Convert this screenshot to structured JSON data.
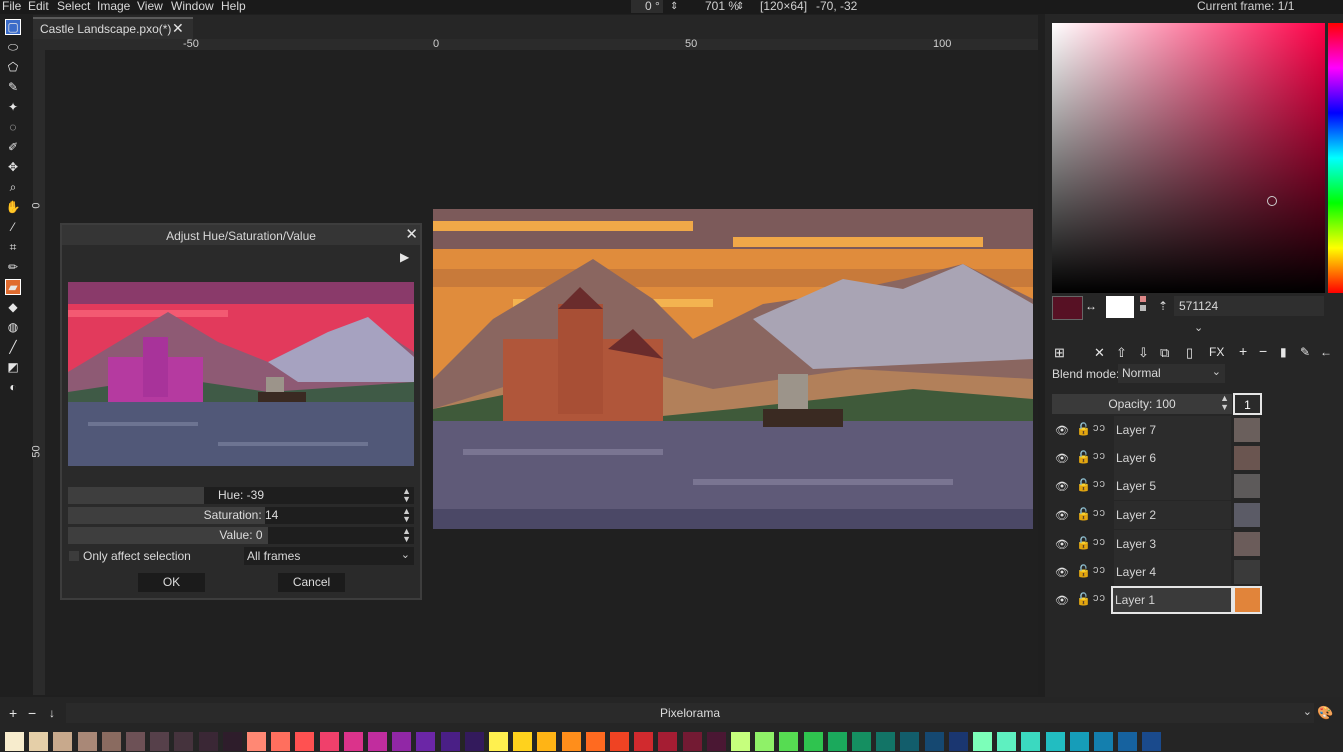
{
  "menu": [
    "File",
    "Edit",
    "Select",
    "Image",
    "View",
    "Window",
    "Help"
  ],
  "status": {
    "rotation": "0 °",
    "zoom": "701 %",
    "canvas_size": "[120×64]",
    "cursor": "-70, -32",
    "current_frame": "Current frame: 1/1"
  },
  "tab": {
    "label": "Castle Landscape.pxo(*)",
    "close": "✕"
  },
  "ruler_top": [
    "-50",
    "0",
    "50",
    "100"
  ],
  "ruler_left": [
    "0",
    "50"
  ],
  "dialog": {
    "title": "Adjust Hue/Saturation/Value",
    "close": "✕",
    "hue": {
      "label": "Hue: -39",
      "value": -39
    },
    "saturation": {
      "label": "Saturation: 14",
      "value": 14
    },
    "value": {
      "label": "Value: 0",
      "value": 0
    },
    "only_selection": "Only affect selection",
    "affect_option": "All frames",
    "ok": "OK",
    "cancel": "Cancel"
  },
  "color": {
    "hex": "571124",
    "primary": "#571124",
    "secondary": "#ffffff"
  },
  "layers_panel": {
    "blend_label": "Blend mode:",
    "blend_value": "Normal",
    "opacity": "Opacity: 100",
    "frame_number": "1",
    "fx": "FX",
    "layers": [
      {
        "name": "Layer 7",
        "thumb": "#6a5f5c"
      },
      {
        "name": "Layer 6",
        "thumb": "#6a5550"
      },
      {
        "name": "Layer 5",
        "thumb": "#5d5a5a"
      },
      {
        "name": "Layer 2",
        "thumb": "#5b5b66"
      },
      {
        "name": "Layer 3",
        "thumb": "#6b5c5a"
      },
      {
        "name": "Layer 4",
        "thumb": "#3a3a3a"
      },
      {
        "name": "Layer 1",
        "thumb": "#e1843a",
        "selected": true
      }
    ]
  },
  "palette": {
    "name": "Pixelorama",
    "colors": [
      "#f7eccd",
      "#e5cfa8",
      "#c8a98c",
      "#a98877",
      "#8a6b60",
      "#6d5156",
      "#56404a",
      "#45333d",
      "#3a2735",
      "#2e1d2b",
      "#ff8874",
      "#ff6f5e",
      "#ff5151",
      "#f0406b",
      "#db338b",
      "#c12d9e",
      "#9127a6",
      "#6b26a6",
      "#4a1f86",
      "#331a5c",
      "#fff04f",
      "#ffd21d",
      "#ffb415",
      "#ff8e1b",
      "#ff6a20",
      "#ef4323",
      "#d12a2e",
      "#a51d33",
      "#731a33",
      "#4a1733",
      "#c6ff7d",
      "#8ff168",
      "#56dc52",
      "#2fc44f",
      "#1ba95c",
      "#158f61",
      "#127466",
      "#125d6b",
      "#154871",
      "#1a3670",
      "#7cffb9",
      "#5ef0c0",
      "#3bd9c0",
      "#22bdc1",
      "#169db9",
      "#147fae",
      "#16629f",
      "#1a4a8c"
    ]
  }
}
